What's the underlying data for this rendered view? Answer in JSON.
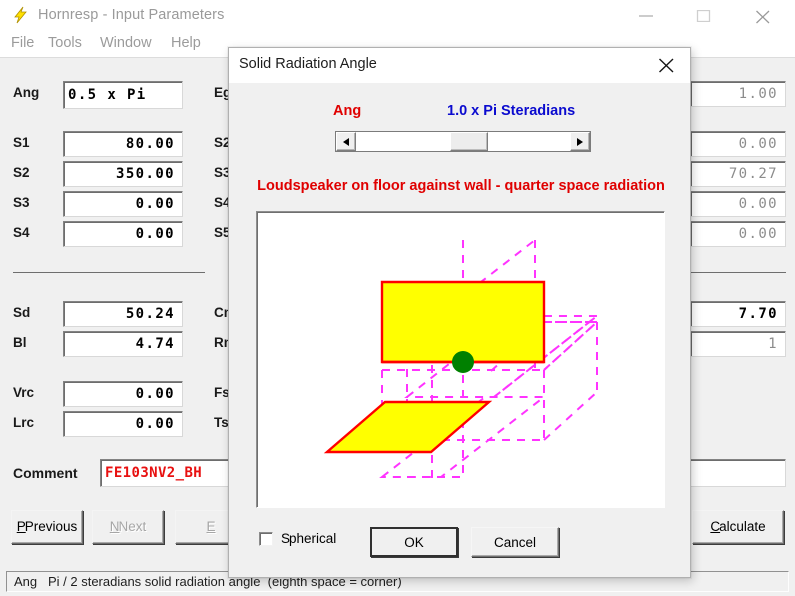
{
  "window": {
    "title": "Hornresp - Input Parameters",
    "icon": "lightning-bolt-icon",
    "controls": {
      "minimize": "minimize-icon",
      "maximize": "maximize-icon",
      "close": "close-icon"
    },
    "menu": [
      "File",
      "Tools",
      "Window",
      "Help"
    ],
    "statusbar": "Ang   Pi / 2 steradians solid radiation angle  (eighth space = corner)"
  },
  "main": {
    "left_fields": [
      {
        "label": "Ang",
        "value": "0.5 x Pi",
        "align": "left"
      },
      {
        "label": "S1",
        "value": "80.00"
      },
      {
        "label": "S2",
        "value": "350.00"
      },
      {
        "label": "S3",
        "value": "0.00"
      },
      {
        "label": "S4",
        "value": "0.00"
      },
      {
        "label": "Sd",
        "value": "50.24"
      },
      {
        "label": "Bl",
        "value": "4.74"
      },
      {
        "label": "Vrc",
        "value": "0.00"
      },
      {
        "label": "Lrc",
        "value": "0.00"
      }
    ],
    "middle_labels": [
      "Eg",
      "S2",
      "S3",
      "S4",
      "S5",
      "Cm",
      "Rm",
      "Fs",
      "Ts"
    ],
    "right_fields": [
      {
        "value": "1.00",
        "state": "disabled"
      },
      {
        "value": "0.00",
        "state": "disabled"
      },
      {
        "value": "70.27",
        "state": "disabled"
      },
      {
        "value": "0.00",
        "state": "disabled"
      },
      {
        "value": "0.00",
        "state": "disabled"
      },
      {
        "value": "7.70",
        "state": "enabled"
      },
      {
        "value": "1",
        "state": "disabled"
      }
    ],
    "comment": {
      "label": "Comment",
      "value": "FE103NV2_BH"
    },
    "buttons": [
      {
        "name": "previous",
        "label": "Previous",
        "accel": "P",
        "state": "enabled"
      },
      {
        "name": "next",
        "label": "Next",
        "accel": "N",
        "state": "disabled"
      },
      {
        "name": "export",
        "label": "E",
        "accel": "E",
        "state": "disabled"
      },
      {
        "name": "calculate",
        "label": "Calculate",
        "accel": "C",
        "state": "enabled"
      }
    ]
  },
  "dialog": {
    "title": "Solid Radiation Angle",
    "close_icon": "close-icon",
    "ang_label": "Ang",
    "steradians_value": "1.0 x Pi Steradians",
    "caption": "Loudspeaker on floor against wall - quarter space radiation",
    "scrollbar": {
      "left_arrow": "arrow-left-icon",
      "right_arrow": "arrow-right-icon",
      "thumb_position_percent": 50
    },
    "checkbox": {
      "label": "Spherical",
      "accel": "S",
      "checked": false
    },
    "ok_label": "OK",
    "cancel_label": "Cancel",
    "colors": {
      "plane_fill": "#ffff00",
      "plane_stroke": "#ff0000",
      "guide_dashed": "#ff33ff",
      "source_dot": "#008000",
      "ang_text": "#e00000",
      "steradians_text": "#0b0bcf"
    }
  }
}
